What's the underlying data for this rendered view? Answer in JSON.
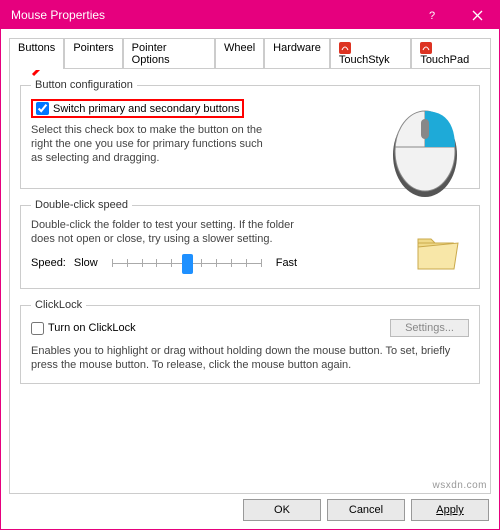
{
  "window": {
    "title": "Mouse Properties"
  },
  "tabs": {
    "buttons": "Buttons",
    "pointers": "Pointers",
    "pointer_options": "Pointer Options",
    "wheel": "Wheel",
    "hardware": "Hardware",
    "touchstyk": "TouchStyk",
    "touchpad": "TouchPad"
  },
  "button_config": {
    "legend": "Button configuration",
    "switch_label": "Switch primary and secondary buttons",
    "switch_checked": true,
    "description": "Select this check box to make the button on the right the one you use for primary functions such as selecting and dragging."
  },
  "double_click": {
    "legend": "Double-click speed",
    "description": "Double-click the folder to test your setting. If the folder does not open or close, try using a slower setting.",
    "speed_label": "Speed:",
    "slow_label": "Slow",
    "fast_label": "Fast"
  },
  "clicklock": {
    "legend": "ClickLock",
    "turn_on_label": "Turn on ClickLock",
    "turn_on_checked": false,
    "settings_button": "Settings...",
    "description": "Enables you to highlight or drag without holding down the mouse button. To set, briefly press the mouse button. To release, click the mouse button again."
  },
  "dialog_buttons": {
    "ok": "OK",
    "cancel": "Cancel",
    "apply": "Apply"
  },
  "watermark": "wsxdn.com"
}
